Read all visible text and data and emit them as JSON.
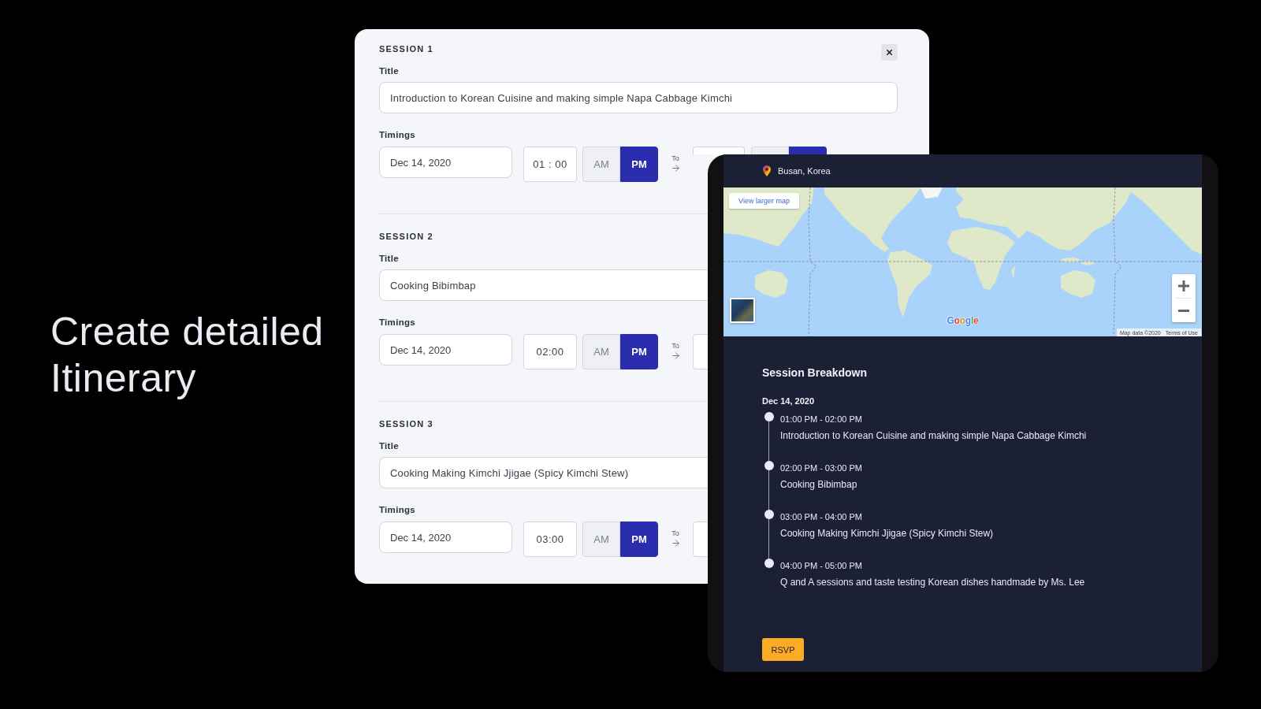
{
  "heading": "Create detailed Itinerary",
  "form": {
    "sessions": [
      {
        "label": "SESSION 1",
        "title_label": "Title",
        "title": "Introduction to Korean Cuisine and making simple Napa Cabbage Kimchi",
        "timings_label": "Timings",
        "date": "Dec 14, 2020",
        "start_time": "01 : 00",
        "meridiem": [
          {
            "label": "AM",
            "selected": false
          },
          {
            "label": "PM",
            "selected": true
          }
        ],
        "to_label": "To",
        "end_meridiem": [
          {
            "selected": false
          },
          {
            "selected": true
          }
        ]
      },
      {
        "label": "SESSION 2",
        "title_label": "Title",
        "title": "Cooking Bibimbap",
        "timings_label": "Timings",
        "date": "Dec 14, 2020",
        "start_time": "02:00",
        "meridiem": [
          {
            "label": "AM",
            "selected": false
          },
          {
            "label": "PM",
            "selected": true
          }
        ],
        "to_label": "To"
      },
      {
        "label": "SESSION 3",
        "title_label": "Title",
        "title": "Cooking Making Kimchi Jjigae (Spicy Kimchi Stew)",
        "timings_label": "Timings",
        "date": "Dec 14, 2020",
        "start_time": "03:00",
        "meridiem": [
          {
            "label": "AM",
            "selected": false
          },
          {
            "label": "PM",
            "selected": true
          }
        ],
        "to_label": "To"
      }
    ]
  },
  "preview": {
    "location": "Busan, Korea",
    "map": {
      "view_larger": "View larger map",
      "logo": "Google",
      "attribution": "Map data ©2020",
      "terms": "Terms of Use"
    },
    "breakdown_title": "Session Breakdown",
    "date": "Dec 14, 2020",
    "items": [
      {
        "time": "01:00 PM - 02:00 PM",
        "title": "Introduction to Korean Cuisine and making simple Napa Cabbage Kimchi"
      },
      {
        "time": "02:00 PM - 03:00 PM",
        "title": "Cooking Bibimbap"
      },
      {
        "time": "03:00 PM - 04:00 PM",
        "title": "Cooking Making Kimchi Jjigae (Spicy Kimchi Stew)"
      },
      {
        "time": "04:00 PM - 05:00 PM",
        "title": "Q and A sessions and taste testing Korean dishes handmade by Ms. Lee"
      }
    ],
    "rsvp": "RSVP"
  }
}
